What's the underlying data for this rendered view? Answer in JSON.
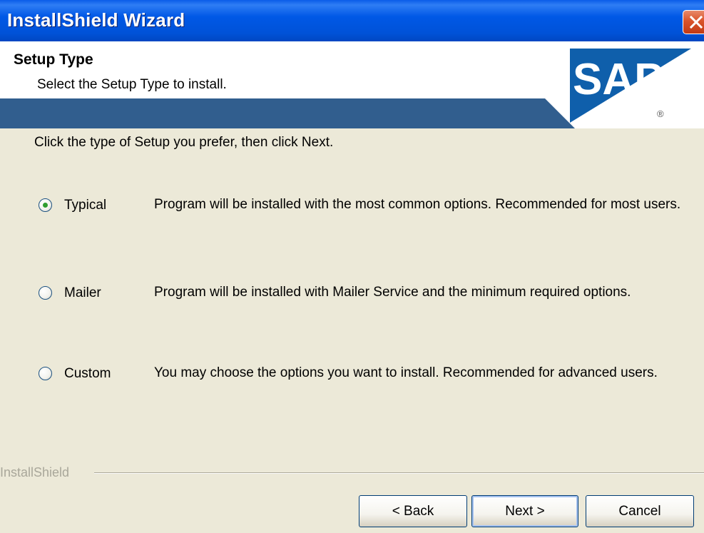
{
  "window": {
    "title": "InstallShield Wizard",
    "close_icon": "close-icon"
  },
  "header": {
    "title": "Setup Type",
    "subtitle": "Select the Setup Type to install.",
    "logo_text": "SAP",
    "logo_registered": "®",
    "band_color": "#315e8e",
    "logo_color": "#0f5fab"
  },
  "body": {
    "instruction": "Click the type of Setup you prefer, then click Next."
  },
  "options": [
    {
      "label": "Typical",
      "selected": true,
      "description": "Program will be installed with the most common options.  Recommended for most users."
    },
    {
      "label": "Mailer",
      "selected": false,
      "description": "Program will be installed with Mailer Service and the minimum required options."
    },
    {
      "label": "Custom",
      "selected": false,
      "description": "You may choose the options you want to install. Recommended for advanced users."
    }
  ],
  "footer": {
    "brand": "InstallShield",
    "back_label": "< Back",
    "next_label": "Next >",
    "cancel_label": "Cancel"
  }
}
